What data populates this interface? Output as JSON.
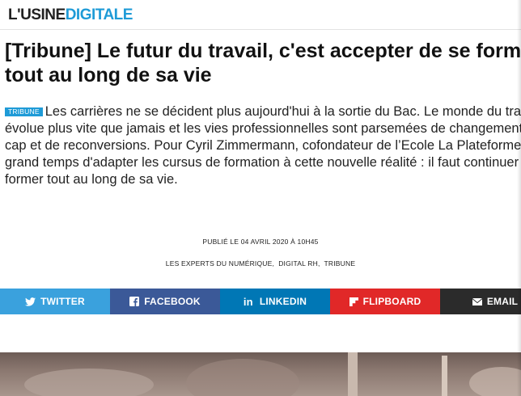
{
  "site": {
    "logo_part1": "L'USINE",
    "logo_part2": "DIGITALE"
  },
  "article": {
    "title": "[Tribune] Le futur du travail, c'est accepter de se former tout au long de sa vie",
    "tag": "TRIBUNE",
    "lead": "Les carrières ne se décident plus aujourd'hui à la sortie du Bac. Le monde du travail évolue plus vite que jamais et les vies professionnelles sont parsemées de changements de cap et de reconversions. Pour Cyril Zimmermann, cofondateur de l’Ecole La Plateforme, il est grand temps d'adapter les cursus de formation à cette nouvelle réalité : il faut continuer à se former tout au long de sa vie.",
    "published": "PUBLIÉ LE 04 AVRIL 2020 À 10H45",
    "categories": [
      "LES EXPERTS DU NUMÉRIQUE",
      "DIGITAL RH",
      "TRIBUNE"
    ]
  },
  "share": {
    "buttons": [
      {
        "label": "TWITTER",
        "icon": "twitter-bird-icon",
        "color": "#3aa1dd"
      },
      {
        "label": "FACEBOOK",
        "icon": "facebook-f-icon",
        "color": "#3b5998"
      },
      {
        "label": "LINKEDIN",
        "icon": "linkedin-in-icon",
        "color": "#0077b5"
      },
      {
        "label": "FLIPBOARD",
        "icon": "flipboard-icon",
        "color": "#e12828"
      },
      {
        "label": "EMAIL",
        "icon": "envelope-icon",
        "color": "#2b2b2b"
      }
    ]
  },
  "colors": {
    "accent": "#1e9bd7"
  }
}
